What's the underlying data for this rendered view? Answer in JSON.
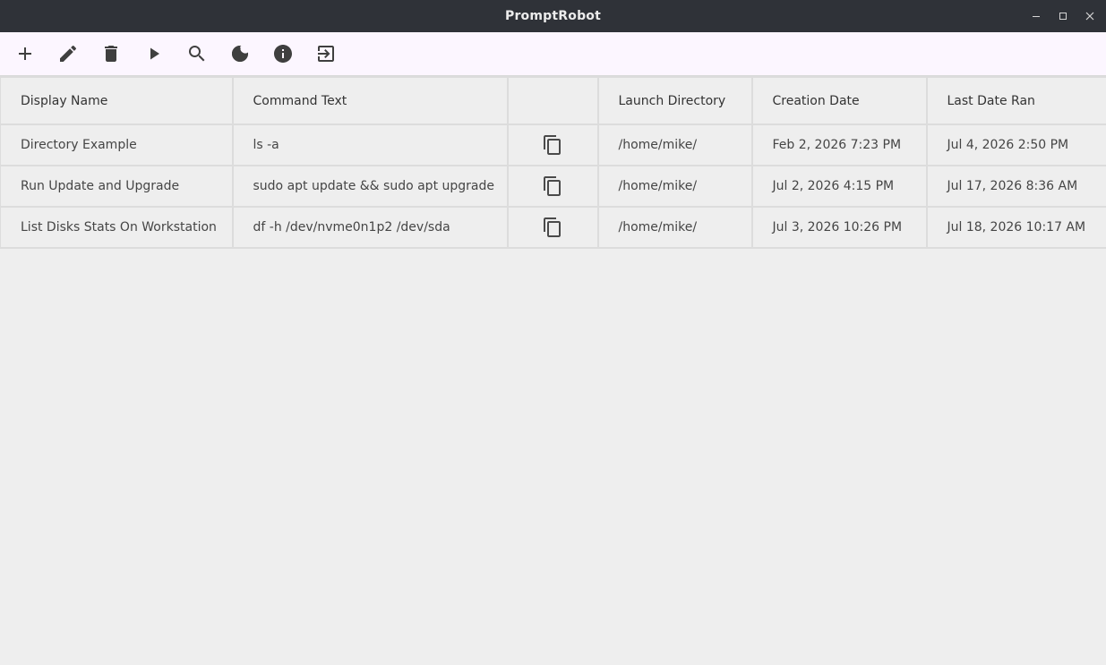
{
  "window": {
    "title": "PromptRobot"
  },
  "toolbar": {
    "buttons": [
      {
        "name": "add-button",
        "icon": "plus-icon"
      },
      {
        "name": "edit-button",
        "icon": "pencil-icon"
      },
      {
        "name": "delete-button",
        "icon": "trash-icon"
      },
      {
        "name": "run-button",
        "icon": "play-icon"
      },
      {
        "name": "search-button",
        "icon": "search-icon"
      },
      {
        "name": "theme-button",
        "icon": "moon-icon"
      },
      {
        "name": "info-button",
        "icon": "info-icon"
      },
      {
        "name": "exit-button",
        "icon": "exit-icon"
      }
    ]
  },
  "table": {
    "headers": [
      "Display Name",
      "Command Text",
      "",
      "Launch Directory",
      "Creation Date",
      "Last Date Ran"
    ],
    "rows": [
      {
        "display_name": "Directory Example",
        "command": "ls -a",
        "directory": "/home/mike/",
        "created": "Feb 2, 2026 7:23 PM",
        "last_ran": "Jul 4, 2026 2:50 PM"
      },
      {
        "display_name": "Run Update and Upgrade",
        "command": "sudo apt update && sudo apt upgrade",
        "directory": "/home/mike/",
        "created": "Jul 2, 2026 4:15 PM",
        "last_ran": "Jul 17, 2026 8:36 AM"
      },
      {
        "display_name": "List Disks Stats On Workstation",
        "command": "df -h /dev/nvme0n1p2 /dev/sda",
        "directory": "/home/mike/",
        "created": "Jul 3, 2026 10:26 PM",
        "last_ran": "Jul 18, 2026 10:17 AM"
      }
    ]
  },
  "colors": {
    "titlebar": "#2f3238",
    "toolbar": "#fcf6ff",
    "background": "#eeeeee",
    "grid_line": "#dcdcdc"
  }
}
